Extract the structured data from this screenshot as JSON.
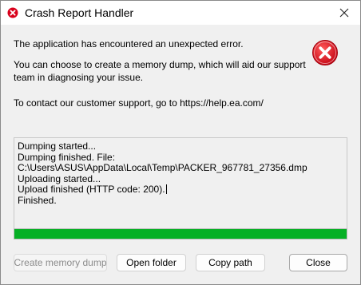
{
  "window": {
    "title": "Crash Report Handler"
  },
  "message": {
    "line1": "The application has encountered an unexpected error.",
    "line2": "You can choose to create a memory dump, which will aid our support",
    "line3": "team in diagnosing your issue.",
    "line4": "To contact our customer support, go to https://help.ea.com/"
  },
  "log": {
    "lines": [
      "Dumping started...",
      "Dumping finished. File:",
      "C:\\Users\\ASUS\\AppData\\Local\\Temp\\PACKER_967781_27356.dmp",
      "Uploading started...",
      "Upload finished (HTTP code: 200).",
      "Finished."
    ]
  },
  "progress": {
    "percent": 100,
    "color": "#06b025"
  },
  "buttons": {
    "create_dump": "Create memory dump",
    "open_folder": "Open folder",
    "copy_path": "Copy path",
    "close": "Close"
  },
  "icons": {
    "title_icon": "error-icon",
    "close_icon": "close-icon",
    "big_icon": "error-icon",
    "error_color": "#e81123"
  }
}
